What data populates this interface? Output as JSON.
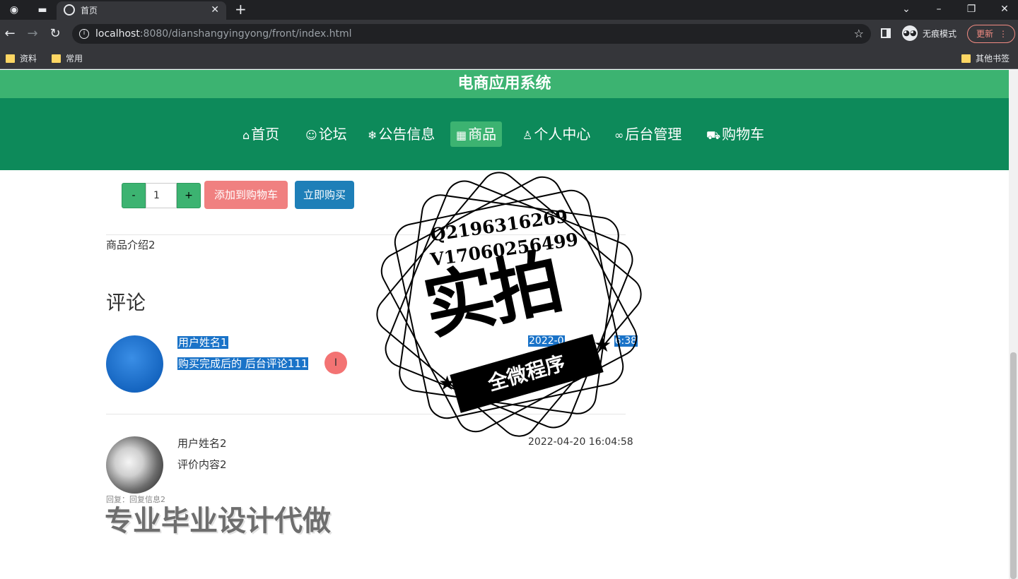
{
  "browser": {
    "tab_title": "首页",
    "url_host": "localhost",
    "url_rest": ":8080/dianshangyingyong/front/index.html",
    "incognito_label": "无痕模式",
    "update_label": "更新",
    "bookmarks": [
      "资料",
      "常用"
    ],
    "other_bookmarks": "其他书签"
  },
  "site": {
    "title": "电商应用系统",
    "nav": [
      {
        "icon": "home-icon",
        "label": "首页"
      },
      {
        "icon": "forum-icon",
        "label": "论坛"
      },
      {
        "icon": "notice-icon",
        "label": "公告信息"
      },
      {
        "icon": "goods-icon",
        "label": "商品",
        "active": true
      },
      {
        "icon": "user-icon",
        "label": "个人中心"
      },
      {
        "icon": "link-icon",
        "label": "后台管理"
      },
      {
        "icon": "cart-icon",
        "label": "购物车"
      }
    ]
  },
  "purchase": {
    "minus": "-",
    "quantity": "1",
    "plus": "+",
    "add_to_cart": "添加到购物车",
    "buy_now": "立即购买"
  },
  "product": {
    "intro": "商品介绍2"
  },
  "comments": {
    "title": "评论",
    "items": [
      {
        "user": "用户姓名1",
        "text": "购买完成后的 后台评论111",
        "time": "2022-0",
        "time_tail": "6:38"
      },
      {
        "user": "用户姓名2",
        "text": "评价内容2",
        "time": "2022-04-20 16:04:58",
        "reply": "回复：回复信息2"
      }
    ]
  },
  "watermark": {
    "qq": "Q2196316269",
    "wx": "V17060256499",
    "big": "实拍",
    "ribbon": "全微程序",
    "bottom": "专业毕业设计代做"
  }
}
